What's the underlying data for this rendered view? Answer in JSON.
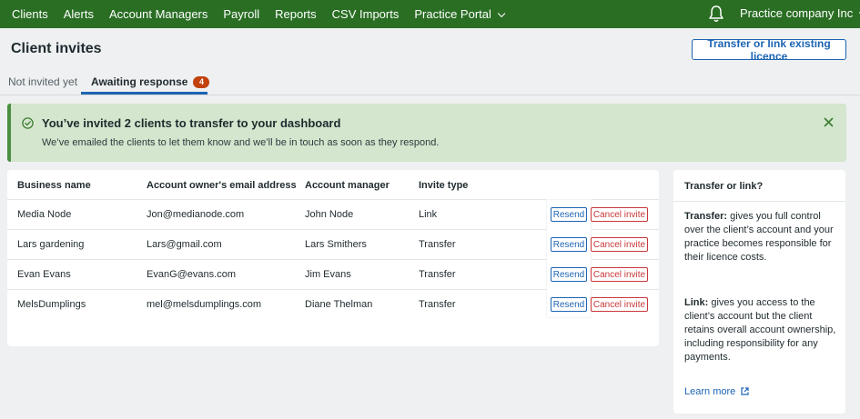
{
  "nav": {
    "items": [
      "Clients",
      "Alerts",
      "Account Managers",
      "Payroll",
      "Reports",
      "CSV Imports",
      "Practice Portal"
    ],
    "company": "Practice company Inc"
  },
  "header": {
    "title": "Client invites",
    "transfer_button": "Transfer or link existing licence"
  },
  "tabs": [
    {
      "label": "Not invited yet"
    },
    {
      "label": "Awaiting response",
      "badge": "4"
    }
  ],
  "banner": {
    "title": "You’ve invited 2 clients to transfer to your dashboard",
    "text": "We’ve emailed the clients to let them know and we’ll be in touch as soon as they respond."
  },
  "table": {
    "headers": [
      "Business name",
      "Account owner's email address",
      "Account manager",
      "Invite type"
    ],
    "rows": [
      {
        "business": "Media Node",
        "email": "Jon@medianode.com",
        "manager": "John Node",
        "type": "Link"
      },
      {
        "business": "Lars gardening",
        "email": "Lars@gmail.com",
        "manager": "Lars Smithers",
        "type": "Transfer"
      },
      {
        "business": "Evan Evans",
        "email": "EvanG@evans.com",
        "manager": "Jim Evans",
        "type": "Transfer"
      },
      {
        "business": "MelsDumplings",
        "email": "mel@melsdumplings.com",
        "manager": "Diane Thelman",
        "type": "Transfer"
      }
    ],
    "resend_label": "Resend",
    "cancel_label": "Cancel invite"
  },
  "side": {
    "title": "Transfer or link?",
    "transfer_term": "Transfer:",
    "transfer_text": " gives you full control over the client’s account and your practice becomes responsible for their licence costs.",
    "link_term": "Link:",
    "link_text": " gives you access to the client’s account but the client retains overall account ownership, including responsibility for any payments.",
    "learn_more": "Learn more"
  },
  "colors": {
    "nav_bg": "#2a6e24",
    "accent": "#1c64b4",
    "danger": "#c9363a",
    "banner_bg": "#d4e6cd",
    "badge": "#c2410c"
  }
}
